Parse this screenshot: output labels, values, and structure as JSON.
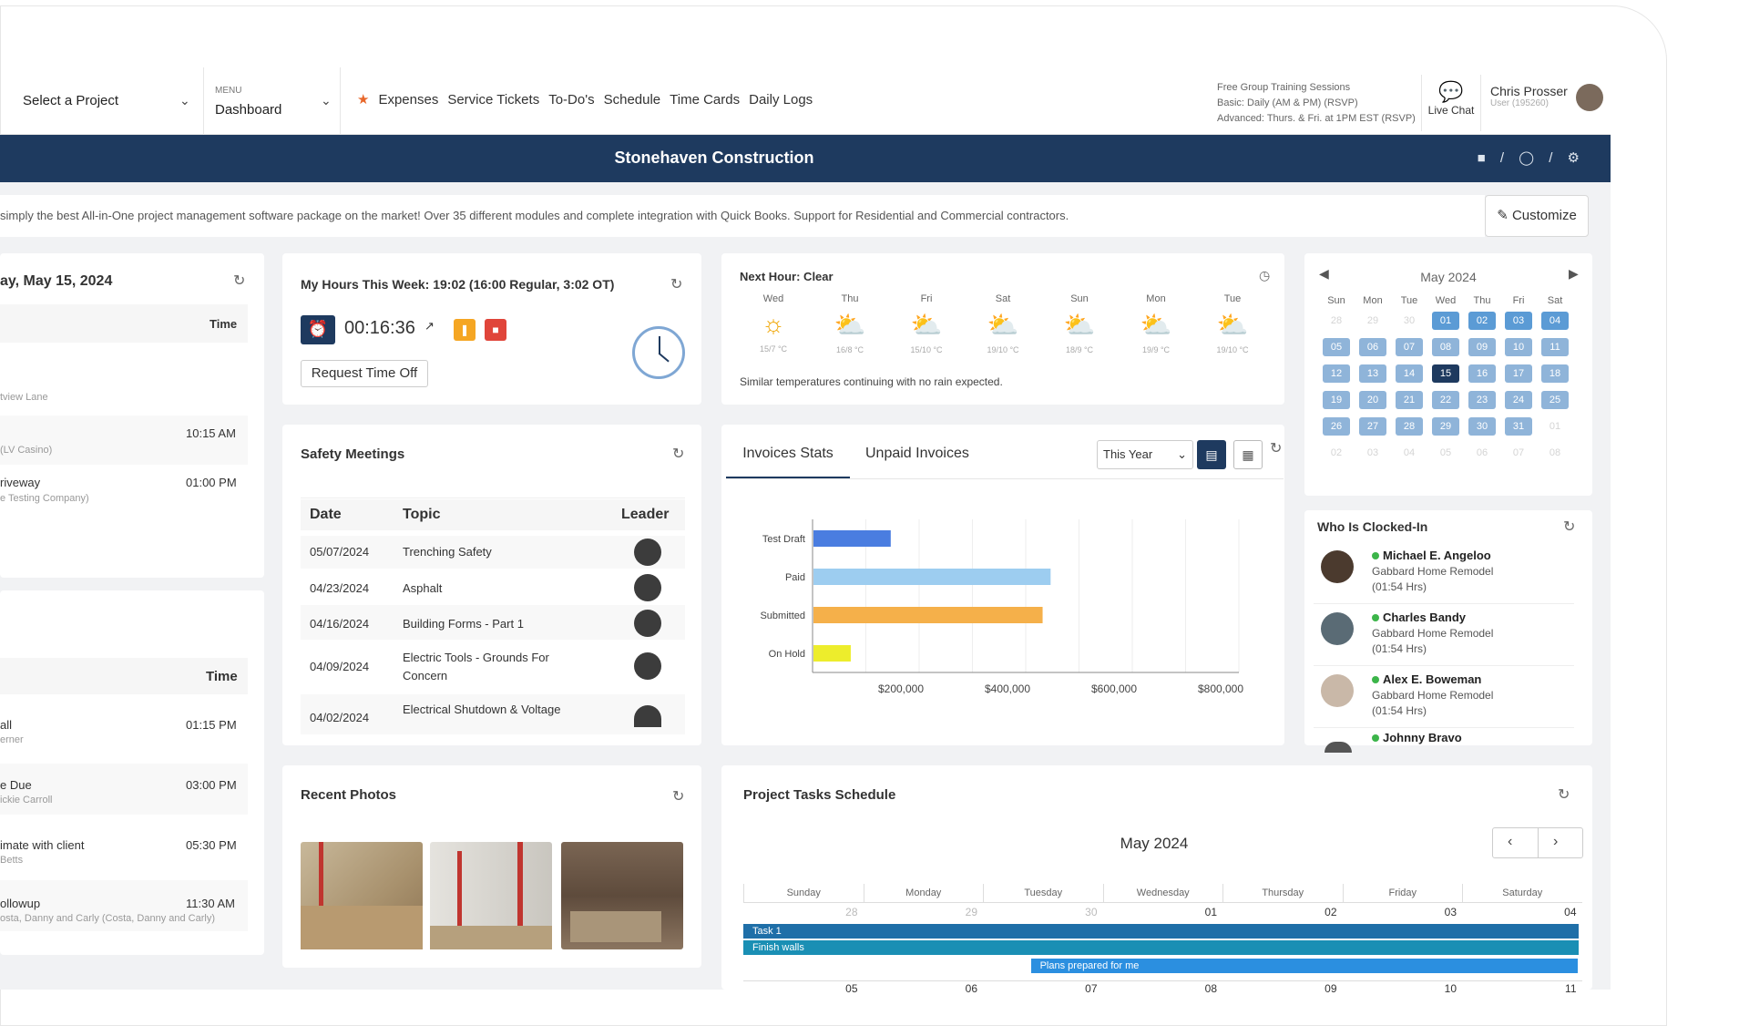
{
  "topbar": {
    "project_select": "Select a Project",
    "menu_caption": "MENU",
    "menu_value": "Dashboard",
    "nav_links": [
      "Expenses",
      "Service Tickets",
      "To-Do's",
      "Schedule",
      "Time Cards",
      "Daily Logs"
    ],
    "training_lines": [
      "Free Group Training Sessions",
      "Basic: Daily (AM & PM) (RSVP)",
      "Advanced: Thurs. & Fri. at 1PM EST (RSVP)"
    ],
    "live_chat": "Live Chat",
    "user_name": "Chris Prosser",
    "user_sub": "User (195260)"
  },
  "banner": {
    "title": "Stonehaven Construction"
  },
  "marquee": "simply the best All-in-One project management software package on the market! Over 35 different modules and complete integration with Quick Books. Support for Residential and Commercial contractors.",
  "customize": "Customize",
  "left_panel": {
    "date": "ay, May 15, 2024",
    "time_header_1": "Time",
    "items_1": [
      {
        "title": "tview Lane",
        "sub": "",
        "time": ""
      },
      {
        "title": "",
        "sub": "(LV Casino)",
        "time": "10:15 AM"
      },
      {
        "title": "riveway",
        "sub": "e Testing Company)",
        "time": "01:00 PM"
      }
    ],
    "time_header_2": "Time",
    "items_2": [
      {
        "title": "all",
        "sub": "erner",
        "time": "01:15 PM"
      },
      {
        "title": "e Due",
        "sub": "ickie Carroll",
        "time": "03:00 PM"
      },
      {
        "title": "imate with client",
        "sub": "Betts",
        "time": "05:30 PM"
      },
      {
        "title": "ollowup",
        "sub": "osta, Danny and Carly (Costa, Danny and Carly)",
        "time": "11:30 AM"
      }
    ]
  },
  "hours": {
    "title": "My Hours This Week: 19:02 (16:00 Regular, 3:02 OT)",
    "timer": "00:16:36",
    "request_off": "Request Time Off"
  },
  "safety": {
    "title": "Safety Meetings",
    "headers": [
      "Date",
      "Topic",
      "Leader"
    ],
    "rows": [
      {
        "date": "05/07/2024",
        "topic": "Trenching Safety",
        "topic2": ""
      },
      {
        "date": "04/23/2024",
        "topic": "Asphalt",
        "topic2": ""
      },
      {
        "date": "04/16/2024",
        "topic": "Building Forms - Part 1",
        "topic2": ""
      },
      {
        "date": "04/09/2024",
        "topic": "Electric Tools - Grounds For",
        "topic2": "Concern"
      },
      {
        "date": "04/02/2024",
        "topic": "Electrical Shutdown & Voltage",
        "topic2": ""
      }
    ]
  },
  "photos": {
    "title": "Recent Photos"
  },
  "weather": {
    "title": "Next Hour: Clear",
    "days": [
      {
        "d": "Wed",
        "t": "15/7 °C",
        "icon": "sun-icon"
      },
      {
        "d": "Thu",
        "t": "16/8 °C",
        "icon": "sun-cloud-icon"
      },
      {
        "d": "Fri",
        "t": "15/10 °C",
        "icon": "sun-cloud-icon"
      },
      {
        "d": "Sat",
        "t": "19/10 °C",
        "icon": "sun-cloud-icon"
      },
      {
        "d": "Sun",
        "t": "18/9 °C",
        "icon": "sun-cloud-icon"
      },
      {
        "d": "Mon",
        "t": "19/9 °C",
        "icon": "sun-cloud-icon"
      },
      {
        "d": "Tue",
        "t": "19/10 °C",
        "icon": "sun-cloud-icon"
      }
    ],
    "note": "Similar temperatures continuing with no rain expected."
  },
  "invoices": {
    "tab1": "Invoices Stats",
    "tab2": "Unpaid Invoices",
    "period": "This Year"
  },
  "chart_data": {
    "type": "bar",
    "orientation": "horizontal",
    "categories": [
      "Test Draft",
      "Paid",
      "Submitted",
      "On Hold"
    ],
    "values": [
      145000,
      445000,
      430000,
      70000
    ],
    "colors": [
      "#4a7de0",
      "#9dcdf0",
      "#f5b04a",
      "#eded2c"
    ],
    "xticks": [
      "$200,000",
      "$400,000",
      "$600,000",
      "$800,000"
    ],
    "xlim": [
      0,
      800000
    ],
    "grid": true
  },
  "calendar": {
    "month": "May 2024",
    "dow": [
      "Sun",
      "Mon",
      "Tue",
      "Wed",
      "Thu",
      "Fri",
      "Sat"
    ],
    "cells": [
      "28",
      "29",
      "30",
      "01",
      "02",
      "03",
      "04",
      "05",
      "06",
      "07",
      "08",
      "09",
      "10",
      "11",
      "12",
      "13",
      "14",
      "15",
      "16",
      "17",
      "18",
      "19",
      "20",
      "21",
      "22",
      "23",
      "24",
      "25",
      "26",
      "27",
      "28",
      "29",
      "30",
      "31",
      "01",
      "02",
      "03",
      "04",
      "05",
      "06",
      "07",
      "08"
    ],
    "today": "15"
  },
  "clocked": {
    "title": "Who Is Clocked-In",
    "people": [
      {
        "name": "Michael E. Angeloo",
        "company": "Gabbard Home Remodel",
        "hrs": "(01:54 Hrs)"
      },
      {
        "name": "Charles Bandy",
        "company": "Gabbard Home Remodel",
        "hrs": "(01:54 Hrs)"
      },
      {
        "name": "Alex E. Boweman",
        "company": "Gabbard Home Remodel",
        "hrs": "(01:54 Hrs)"
      },
      {
        "name": "Johnny Bravo",
        "company": "",
        "hrs": ""
      }
    ]
  },
  "schedule": {
    "title": "Project Tasks Schedule",
    "month": "May 2024",
    "days": [
      "Sunday",
      "Monday",
      "Tuesday",
      "Wednesday",
      "Thursday",
      "Friday",
      "Saturday"
    ],
    "week1": [
      "",
      "28",
      "29",
      "30",
      "01",
      "02",
      "03",
      "04"
    ],
    "week2": [
      "05",
      "06",
      "07",
      "08",
      "09",
      "10",
      "11"
    ],
    "tasks": [
      {
        "label": "Task 1"
      },
      {
        "label": "Finish walls"
      },
      {
        "label": "Plans prepared for me"
      }
    ]
  }
}
